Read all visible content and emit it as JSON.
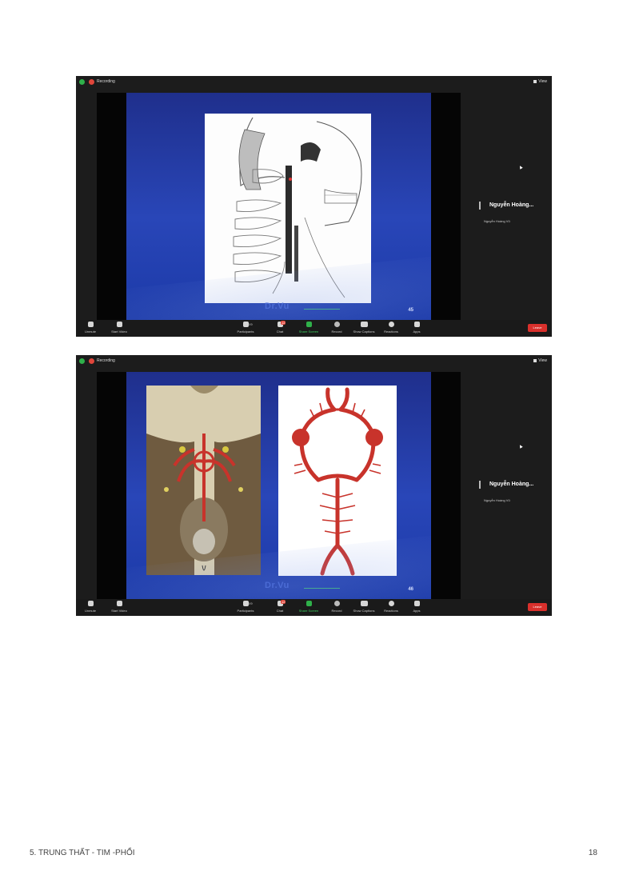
{
  "screens": [
    {
      "recording": "Recording",
      "view": "View",
      "watermark": "Dr.Vu",
      "slide_number": "45",
      "speaker_name": "Nguyễn Hoàng...",
      "speaker_sub": "Nguyễn Hoàng Vũ",
      "toolbar": {
        "unmute": "Unmute",
        "start_video": "Start Video",
        "participants": "Participants",
        "participants_count": "2/9",
        "chat": "Chat",
        "chat_badge": "12",
        "share": "Share Screen",
        "record": "Record",
        "captions": "Show Captions",
        "reactions": "Reactions",
        "apps": "Apps",
        "leave": "Leave"
      }
    },
    {
      "recording": "Recording",
      "view": "View",
      "watermark": "Dr.Vu",
      "slide_number": "46",
      "speaker_name": "Nguyễn Hoàng...",
      "speaker_sub": "Nguyễn Hoàng Vũ",
      "toolbar": {
        "unmute": "Unmute",
        "start_video": "Start Video",
        "participants": "Participants",
        "participants_count": "2/9",
        "chat": "Chat",
        "chat_badge": "12",
        "share": "Share Screen",
        "record": "Record",
        "captions": "Show Captions",
        "reactions": "Reactions",
        "apps": "Apps",
        "leave": "Leave"
      }
    }
  ],
  "footer": {
    "left": "5. TRUNG THẤT - TIM -PHỔI",
    "right": "18"
  },
  "colors": {
    "slide_blue": "#2946b8",
    "artery_red": "#c8332b",
    "leave_red": "#d9302c",
    "share_green": "#2fb04a"
  }
}
